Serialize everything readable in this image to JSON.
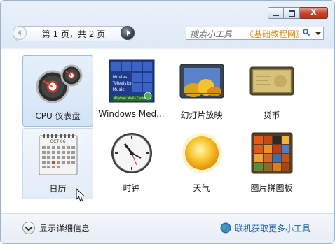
{
  "window": {
    "controls": {
      "minimize_icon": "minimize-icon",
      "maximize_icon": "maximize-icon",
      "close_glyph": "x"
    }
  },
  "pager": {
    "text": "第 1 页，共 2 页",
    "prev_icon": "arrow-left-icon",
    "next_icon": "arrow-right-icon"
  },
  "search": {
    "placeholder": "搜索小工具",
    "watermark": "《基础教程网》",
    "icon": "search-icon"
  },
  "gadgets": [
    {
      "label": "CPU 仪表盘",
      "icon": "cpu-meter-icon",
      "state": "selected"
    },
    {
      "label": "Windows Med...",
      "icon": "windows-media-center-icon",
      "tile_lines": [
        "Movies",
        "Television",
        "Music"
      ],
      "badge": "Windows Media Center"
    },
    {
      "label": "幻灯片放映",
      "icon": "slideshow-icon"
    },
    {
      "label": "货币",
      "icon": "currency-icon"
    },
    {
      "label": "日历",
      "icon": "calendar-icon",
      "state": "hover",
      "month": "OCT 06"
    },
    {
      "label": "时钟",
      "icon": "clock-icon"
    },
    {
      "label": "天气",
      "icon": "weather-sun-icon"
    },
    {
      "label": "图片拼图板",
      "icon": "picture-puzzle-icon"
    }
  ],
  "footer": {
    "details_label": "显示详细信息",
    "details_icon": "chevron-down-icon",
    "online_label": "联机获取更多小工具",
    "online_icon": "globe-icon"
  },
  "colors": {
    "accent": "#1a5fb4",
    "watermark": "#e08a18",
    "selection": "#d2e4f7"
  }
}
